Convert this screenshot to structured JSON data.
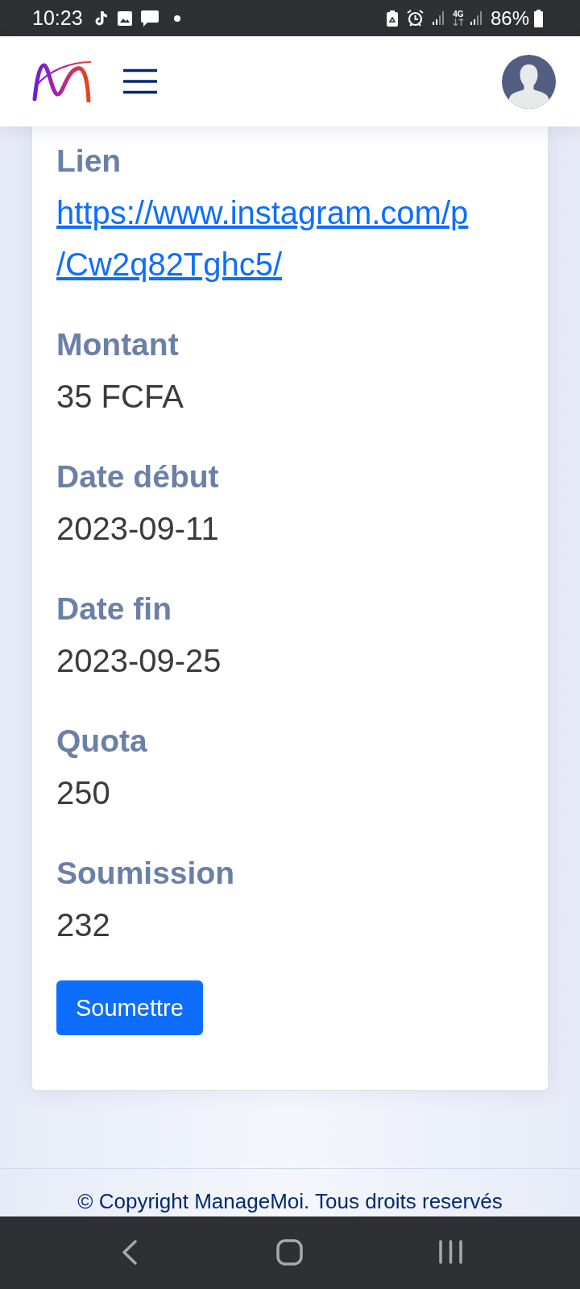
{
  "status_bar": {
    "time": "10:23",
    "network": "4G",
    "battery": "86%"
  },
  "fields": [
    {
      "kind": "link",
      "label": "Lien",
      "value": "https://www.instagram.com/p/Cw2q82Tghc5/"
    },
    {
      "kind": "text",
      "label": "Montant",
      "value": "35 FCFA"
    },
    {
      "kind": "text",
      "label": "Date début",
      "value": "2023-09-11"
    },
    {
      "kind": "text",
      "label": "Date fin",
      "value": "2023-09-25"
    },
    {
      "kind": "text",
      "label": "Quota",
      "value": "250"
    },
    {
      "kind": "text",
      "label": "Soumission",
      "value": "232"
    }
  ],
  "submit_button": "Soumettre",
  "footer": "© Copyright ManageMoi. Tous droits reservés"
}
